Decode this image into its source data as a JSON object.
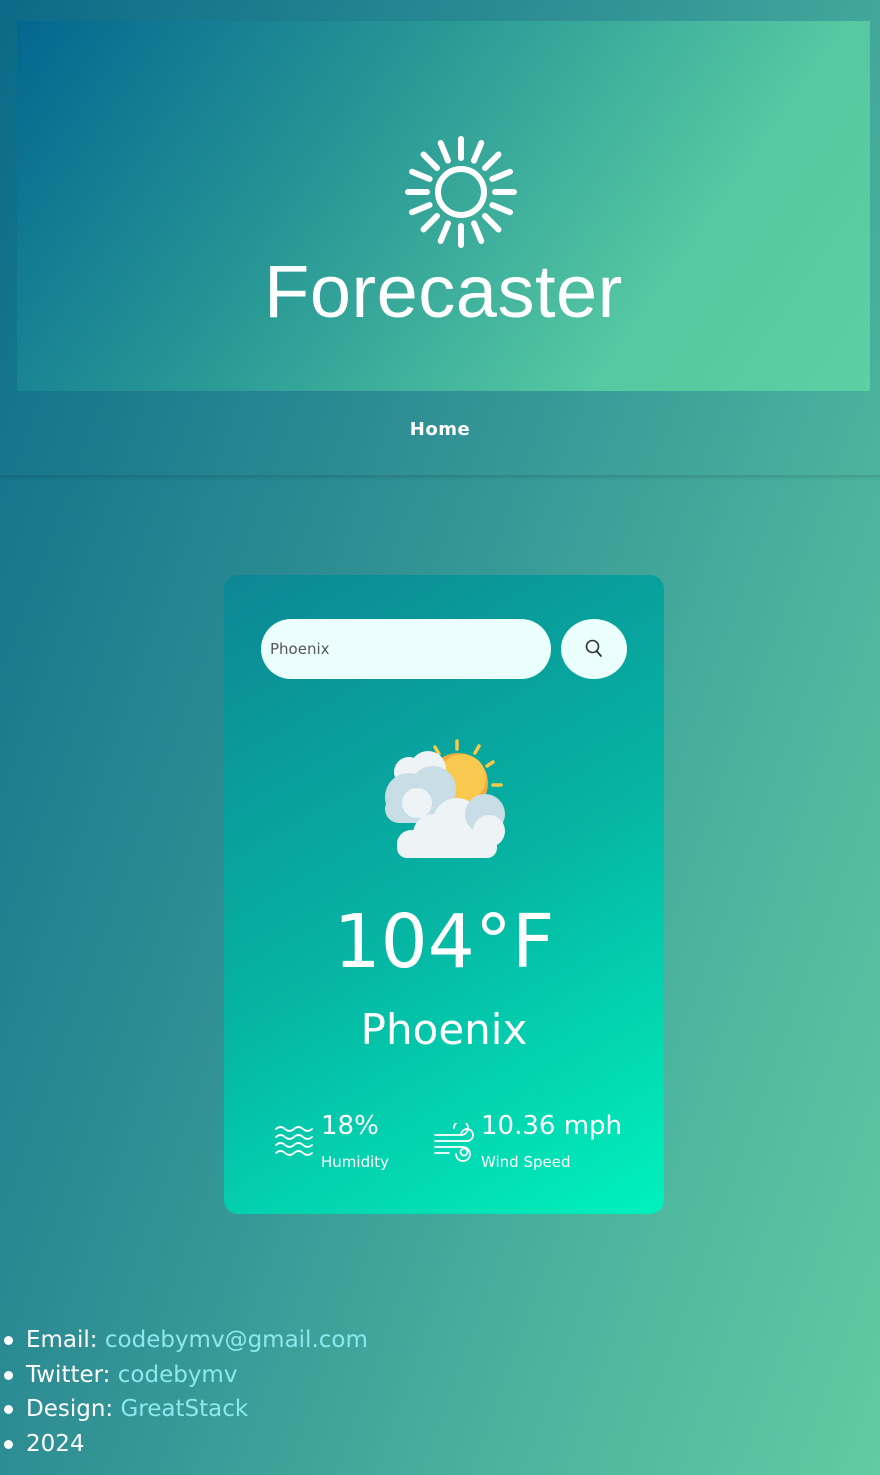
{
  "app": {
    "title": "Forecaster",
    "logo_icon": "sun-icon"
  },
  "nav": {
    "home_label": "Home"
  },
  "search": {
    "value": "Phoenix",
    "button_icon": "search-icon"
  },
  "weather": {
    "icon": "partly-cloudy-icon",
    "temperature": "104°F",
    "city": "Phoenix",
    "humidity_value": "18%",
    "humidity_label": "Humidity",
    "humidity_icon": "humidity-waves-icon",
    "wind_value": "10.36 mph",
    "wind_label": "Wind Speed",
    "wind_icon": "wind-icon"
  },
  "footer": {
    "email_label": "Email: ",
    "email_link": "codebymv@gmail.com",
    "twitter_label": "Twitter: ",
    "twitter_link": "codebymv",
    "design_label": "Design: ",
    "design_link": "GreatStack",
    "year": "2024"
  },
  "colors": {
    "link": "#8de8ee",
    "card_gradient_end": "#00f2bd",
    "input_bg": "#ebfffc"
  }
}
